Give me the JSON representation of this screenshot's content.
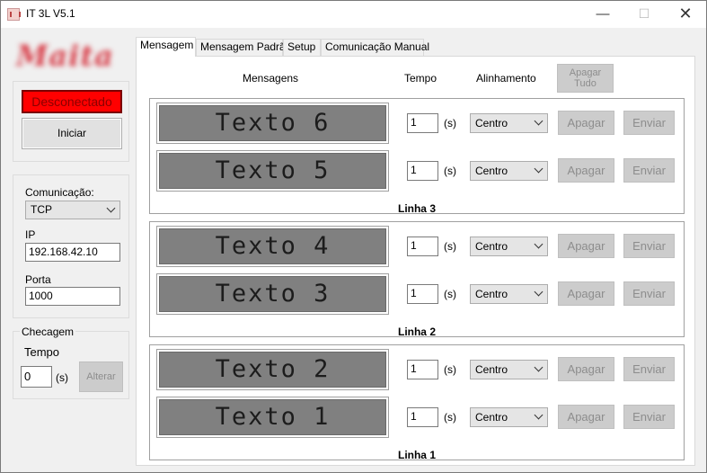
{
  "window": {
    "title": "IT 3L V5.1",
    "minimize": "—",
    "maximize": "☐",
    "close": "✕"
  },
  "left": {
    "logo_text": "Maita",
    "status": "Desconectado",
    "start_button": "Iniciar",
    "comm_label": "Comunicação:",
    "comm_value": "TCP",
    "ip_label": "IP",
    "ip_value": "192.168.42.10",
    "port_label": "Porta",
    "port_value": "1000",
    "check_title": "Checagem",
    "check_time_label": "Tempo",
    "check_time_value": "0",
    "check_unit": "(s)",
    "alter_button": "Alterar"
  },
  "tabs": [
    "Mensagem",
    "Mensagem Padrão",
    "Setup",
    "Comunicação Manual"
  ],
  "headers": {
    "messages": "Mensagens",
    "time": "Tempo",
    "alignment": "Alinhamento",
    "clear_all": "Apagar Tudo"
  },
  "groups": [
    {
      "label": "Linha 3",
      "rows": [
        {
          "text": "Texto 6",
          "time": "1",
          "unit": "(s)",
          "align": "Centro",
          "clear": "Apagar",
          "send": "Enviar"
        },
        {
          "text": "Texto 5",
          "time": "1",
          "unit": "(s)",
          "align": "Centro",
          "clear": "Apagar",
          "send": "Enviar"
        }
      ]
    },
    {
      "label": "Linha 2",
      "rows": [
        {
          "text": "Texto 4",
          "time": "1",
          "unit": "(s)",
          "align": "Centro",
          "clear": "Apagar",
          "send": "Enviar"
        },
        {
          "text": "Texto 3",
          "time": "1",
          "unit": "(s)",
          "align": "Centro",
          "clear": "Apagar",
          "send": "Enviar"
        }
      ]
    },
    {
      "label": "Linha 1",
      "rows": [
        {
          "text": "Texto 2",
          "time": "1",
          "unit": "(s)",
          "align": "Centro",
          "clear": "Apagar",
          "send": "Enviar"
        },
        {
          "text": "Texto 1",
          "time": "1",
          "unit": "(s)",
          "align": "Centro",
          "clear": "Apagar",
          "send": "Enviar"
        }
      ]
    }
  ],
  "colors": {
    "status_red": "#ff0000",
    "lcd_bg": "#808080",
    "disabled_btn": "#cccccc"
  }
}
